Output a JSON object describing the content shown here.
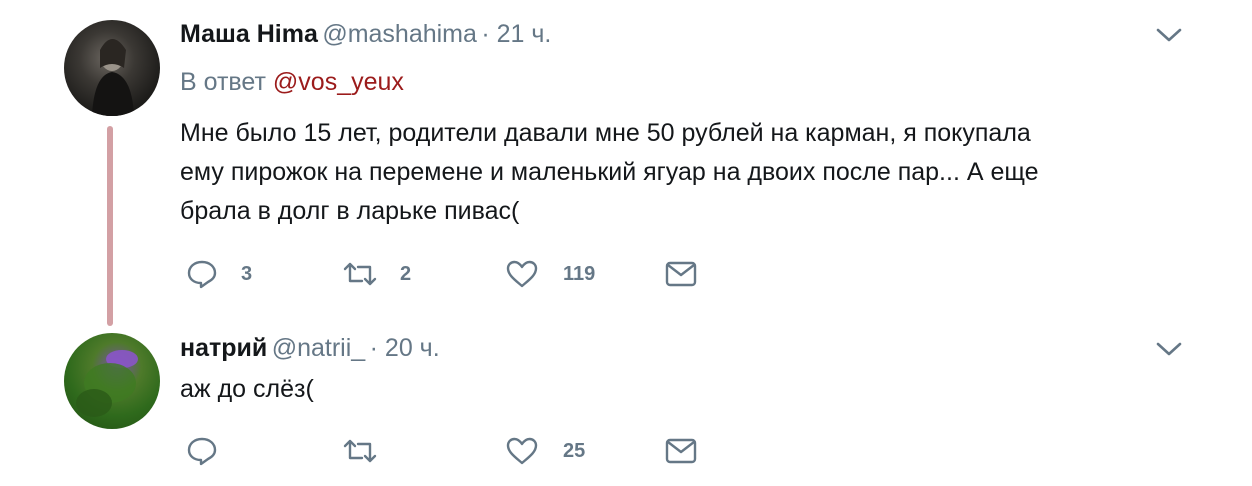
{
  "tweets": [
    {
      "name": "Маша Hima",
      "handle": "@mashahima",
      "time": "· 21 ч.",
      "reply_prefix": "В ответ",
      "reply_to": "@vos_yeux",
      "lines": [
        "Мне было 15 лет, родители давали мне 50 рублей на карман, я покупала",
        "ему пирожок на перемене и маленький ягуар на двоих после пар... А еще",
        "брала в долг в ларьке пивас("
      ],
      "replies": "3",
      "retweets": "2",
      "likes": "119"
    },
    {
      "name": "натрий",
      "handle": "@natrii_",
      "time": "· 20 ч.",
      "lines": [
        "аж до слёз("
      ],
      "replies": "",
      "retweets": "",
      "likes": "25"
    }
  ],
  "icons": [
    "reply-icon",
    "retweet-icon",
    "like-icon",
    "message-icon",
    "chevron-down-icon"
  ],
  "colors": {
    "muted": "#657786",
    "link": "#9b1b1b",
    "thread": "#d3a0a4"
  }
}
